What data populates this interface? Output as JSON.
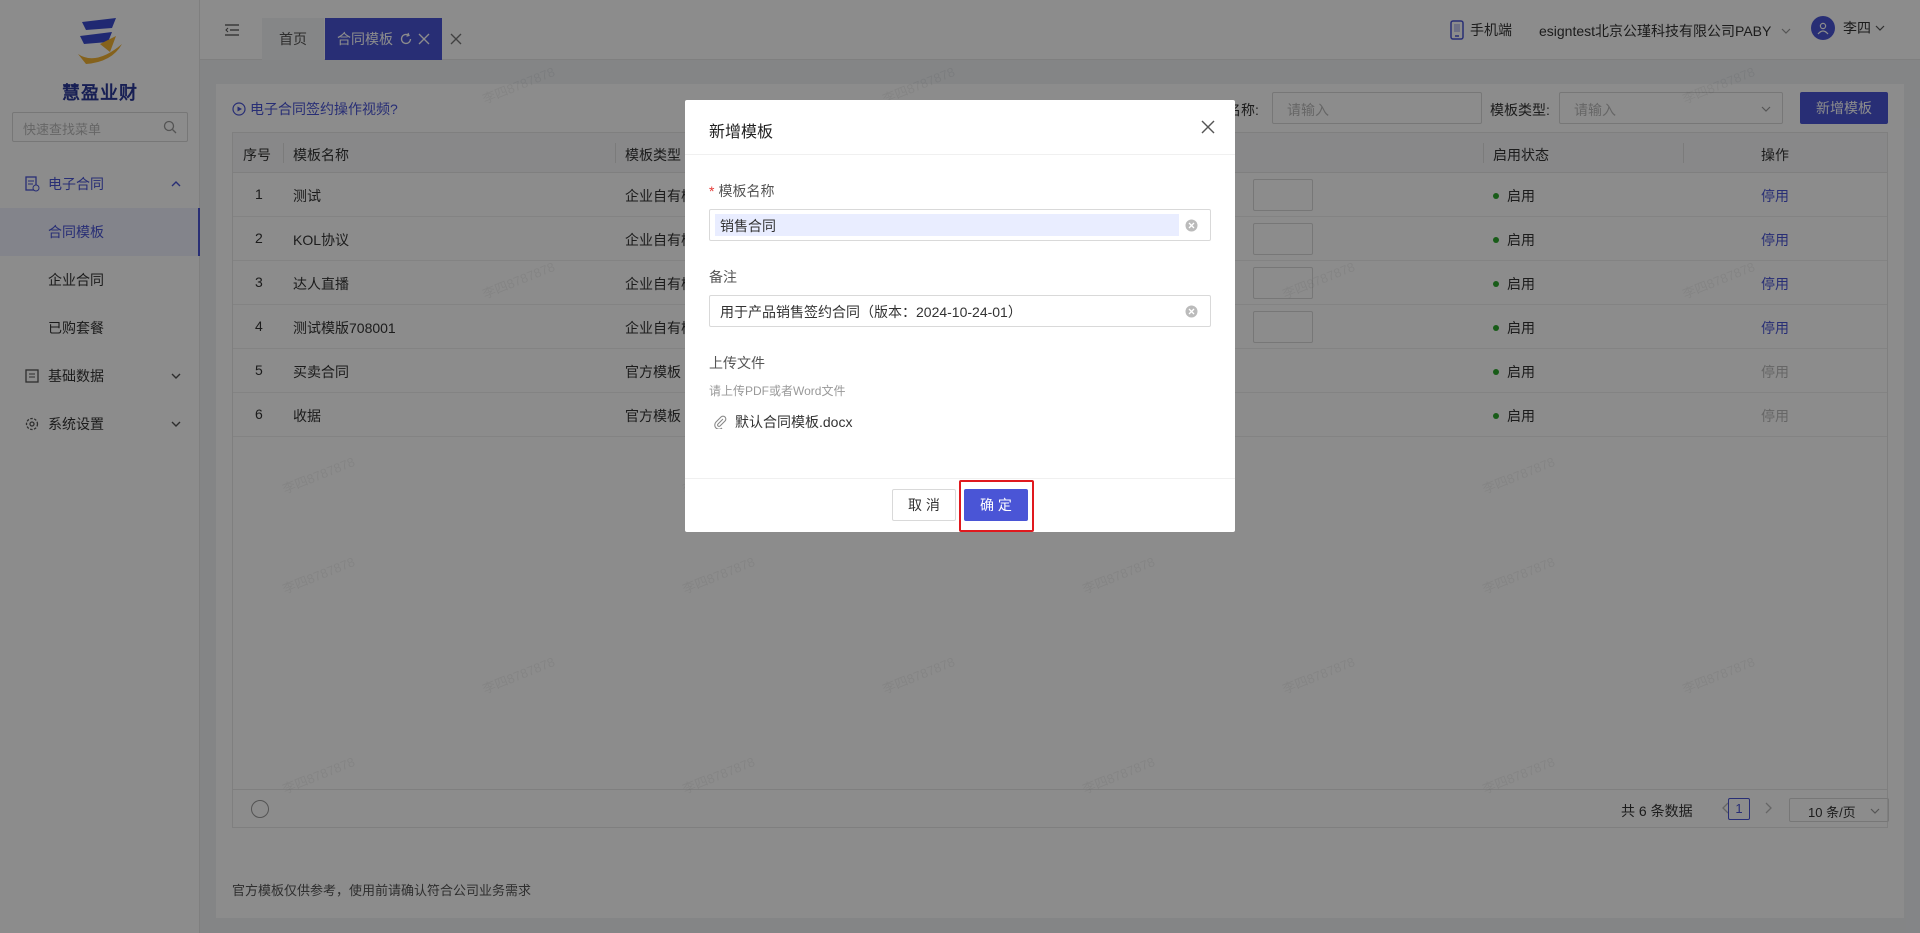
{
  "app": {
    "logo_text": "慧盈业财",
    "search_placeholder": "快速查找菜单"
  },
  "sidebar": {
    "groups": [
      {
        "label": "电子合同",
        "icon": "contract-icon",
        "expanded": true,
        "items": [
          {
            "label": "合同模板",
            "active": true
          },
          {
            "label": "企业合同",
            "active": false
          },
          {
            "label": "已购套餐",
            "active": false
          }
        ]
      },
      {
        "label": "基础数据",
        "icon": "database-icon",
        "expanded": false
      },
      {
        "label": "系统设置",
        "icon": "gear-icon",
        "expanded": false
      }
    ]
  },
  "header": {
    "tabs": [
      {
        "label": "首页"
      },
      {
        "label": "合同模板"
      }
    ],
    "mobile_label": "手机端",
    "company": "esigntest北京公瑾科技有限公司PABY",
    "user": "李四"
  },
  "page": {
    "video_link": "电子合同签约操作视频?",
    "filter_name_label": "名称:",
    "filter_name_placeholder": "请输入",
    "filter_type_label": "模板类型:",
    "filter_type_placeholder": "请输入",
    "new_button": "新增模板",
    "columns": [
      "序号",
      "模板名称",
      "模板类型",
      "启用状态",
      "操作"
    ],
    "rows": [
      {
        "no": "1",
        "name": "测试",
        "type": "企业自有模",
        "status": "启用",
        "action": "停用",
        "action_enabled": true
      },
      {
        "no": "2",
        "name": "KOL协议",
        "type": "企业自有模",
        "status": "启用",
        "action": "停用",
        "action_enabled": true
      },
      {
        "no": "3",
        "name": "达人直播",
        "type": "企业自有模",
        "status": "启用",
        "action": "停用",
        "action_enabled": true
      },
      {
        "no": "4",
        "name": "测试模版708001",
        "type": "企业自有模",
        "status": "启用",
        "action": "停用",
        "action_enabled": true
      },
      {
        "no": "5",
        "name": "买卖合同",
        "type": "官方模板",
        "status": "启用",
        "action": "停用",
        "action_enabled": false
      },
      {
        "no": "6",
        "name": "收据",
        "type": "官方模板",
        "status": "启用",
        "action": "停用",
        "action_enabled": false
      }
    ],
    "pagination": {
      "total": "共 6 条数据",
      "current": "1",
      "page_size": "10 条/页"
    },
    "footnote": "官方模板仅供参考，使用前请确认符合公司业务需求",
    "watermark": "李四8787878"
  },
  "modal": {
    "title": "新增模板",
    "name_label": "模板名称",
    "name_value": "销售合同",
    "remark_label": "备注",
    "remark_value": "用于产品销售签约合同（版本：2024-10-24-01）",
    "upload_label": "上传文件",
    "upload_hint": "请上传PDF或者Word文件",
    "file_name": "默认合同模板.docx",
    "cancel": "取 消",
    "confirm": "确 定"
  },
  "colors": {
    "accent": "#4a55d6",
    "status_green": "#2ca82c",
    "highlight_red": "#e0191e"
  }
}
